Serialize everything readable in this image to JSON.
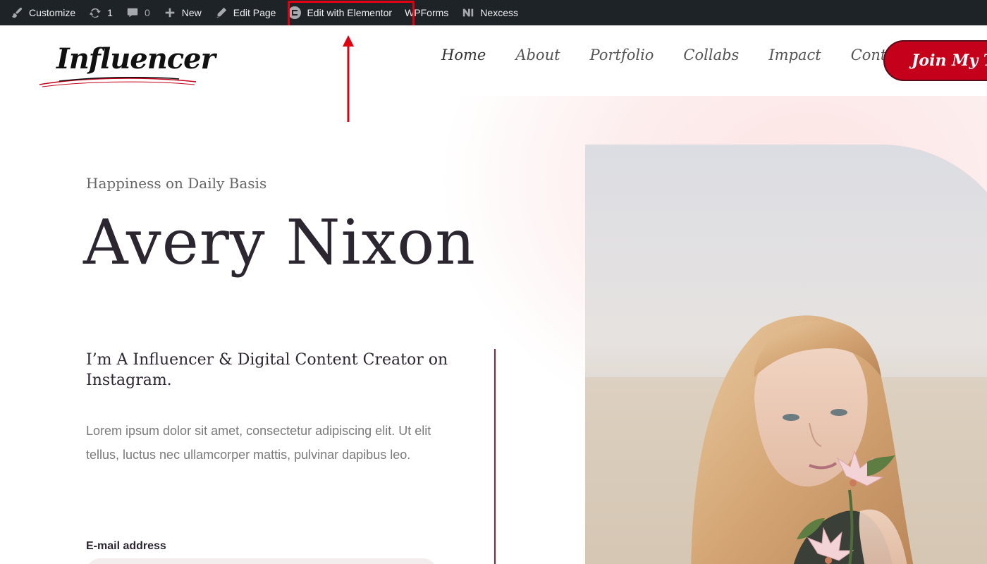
{
  "adminbar": {
    "customize": "Customize",
    "updates_count": "1",
    "comments_count": "0",
    "new": "New",
    "edit_page": "Edit Page",
    "edit_elementor": "Edit with Elementor",
    "wpforms": "WPForms",
    "nexcess": "Nexcess"
  },
  "header": {
    "logo_text": "Influencer",
    "nav": [
      "Home",
      "About",
      "Portfolio",
      "Collabs",
      "Impact",
      "Contact"
    ],
    "cta": "Join My Team"
  },
  "hero": {
    "subtitle": "Happiness on Daily Basis",
    "name": "Avery Nixon",
    "tagline": "I’m A Influencer & Digital Content Creator on Instagram.",
    "body": "Lorem ipsum dolor sit amet, consectetur adipiscing elit. Ut elit tellus, luctus nec ullamcorper mattis, pulvinar dapibus leo.",
    "email_label": "E-mail address"
  },
  "colors": {
    "adminbar_bg": "#1d2327",
    "accent_red": "#c4001a",
    "highlight_red": "#e0000f",
    "text_dark": "#2c2630"
  }
}
